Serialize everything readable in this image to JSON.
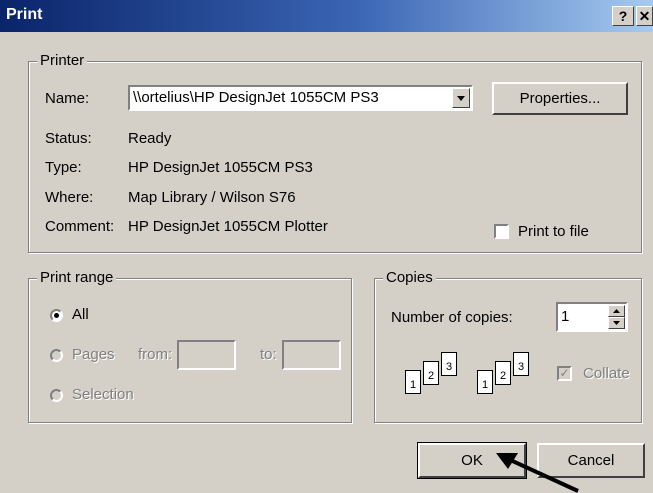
{
  "window": {
    "title": "Print",
    "help_button": "?",
    "close_button": "✕"
  },
  "printer": {
    "group_label": "Printer",
    "name_label": "Name:",
    "name_value": "\\\\ortelius\\HP DesignJet 1055CM PS3",
    "properties_label": "Properties...",
    "status_label": "Status:",
    "status_value": "Ready",
    "type_label": "Type:",
    "type_value": "HP DesignJet 1055CM PS3",
    "where_label": "Where:",
    "where_value": "Map Library / Wilson S76",
    "comment_label": "Comment:",
    "comment_value": "HP DesignJet 1055CM Plotter",
    "print_to_file_label": "Print to file",
    "print_to_file_checked": false
  },
  "print_range": {
    "group_label": "Print range",
    "all_label": "All",
    "pages_label": "Pages",
    "from_label": "from:",
    "from_value": "",
    "to_label": "to:",
    "to_value": "",
    "selection_label": "Selection",
    "selected": "All"
  },
  "copies": {
    "group_label": "Copies",
    "number_label": "Number of copies:",
    "number_value": "1",
    "collate_label": "Collate",
    "collate_checked": true,
    "collate_icon_pages": [
      "1",
      "2",
      "3"
    ]
  },
  "actions": {
    "ok_label": "OK",
    "cancel_label": "Cancel"
  },
  "colors": {
    "dialog_background": "#d4d0c8",
    "titlebar_start": "#0a246a",
    "titlebar_end": "#a6caf0"
  },
  "icons": {
    "help": "help-icon",
    "close": "close-icon",
    "dropdown": "chevron-down-icon",
    "pointer": "arrow-pointer-icon"
  }
}
